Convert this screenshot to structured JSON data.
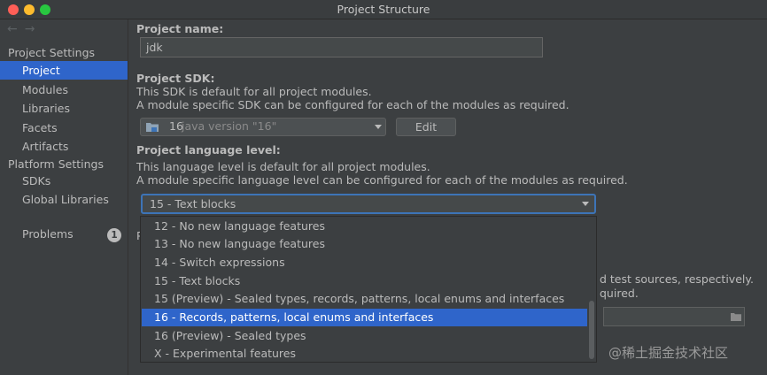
{
  "window": {
    "title": "Project Structure"
  },
  "sidebar": {
    "project_settings_heading": "Project Settings",
    "platform_settings_heading": "Platform Settings",
    "items": [
      {
        "label": "Project",
        "selected": true
      },
      {
        "label": "Modules"
      },
      {
        "label": "Libraries"
      },
      {
        "label": "Facets"
      },
      {
        "label": "Artifacts"
      }
    ],
    "platform_items": [
      {
        "label": "SDKs"
      },
      {
        "label": "Global Libraries"
      }
    ],
    "problems": {
      "label": "Problems",
      "count": "1"
    }
  },
  "project_name": {
    "label": "Project name:",
    "value": "jdk"
  },
  "project_sdk": {
    "label": "Project SDK:",
    "desc1": "This SDK is default for all project modules.",
    "desc2": "A module specific SDK can be configured for each of the modules as required.",
    "selected_num": "16",
    "selected_version": "java version \"16\"",
    "edit_button": "Edit"
  },
  "language_level": {
    "label": "Project language level:",
    "desc1": "This language level is default for all project modules.",
    "desc2": "A module specific language level can be configured for each of the modules as required.",
    "selected": "15 - Text blocks",
    "options": [
      {
        "label": "12 - No new language features"
      },
      {
        "label": "13 - No new language features"
      },
      {
        "label": "14 - Switch expressions"
      },
      {
        "label": "15 - Text blocks"
      },
      {
        "label": "15 (Preview) - Sealed types, records, patterns, local enums and interfaces"
      },
      {
        "label": "16 - Records, patterns, local enums and interfaces",
        "highlighted": true
      },
      {
        "label": "16 (Preview) - Sealed types"
      },
      {
        "label": "X - Experimental features"
      }
    ]
  },
  "compiler_output": {
    "partial_line1": "d test sources, respectively.",
    "partial_line2": "quired."
  },
  "watermark": "@稀土掘金技术社区",
  "colors": {
    "selection": "#2f65ca",
    "background": "#3c3f41",
    "focus_border": "#3d74b7"
  }
}
